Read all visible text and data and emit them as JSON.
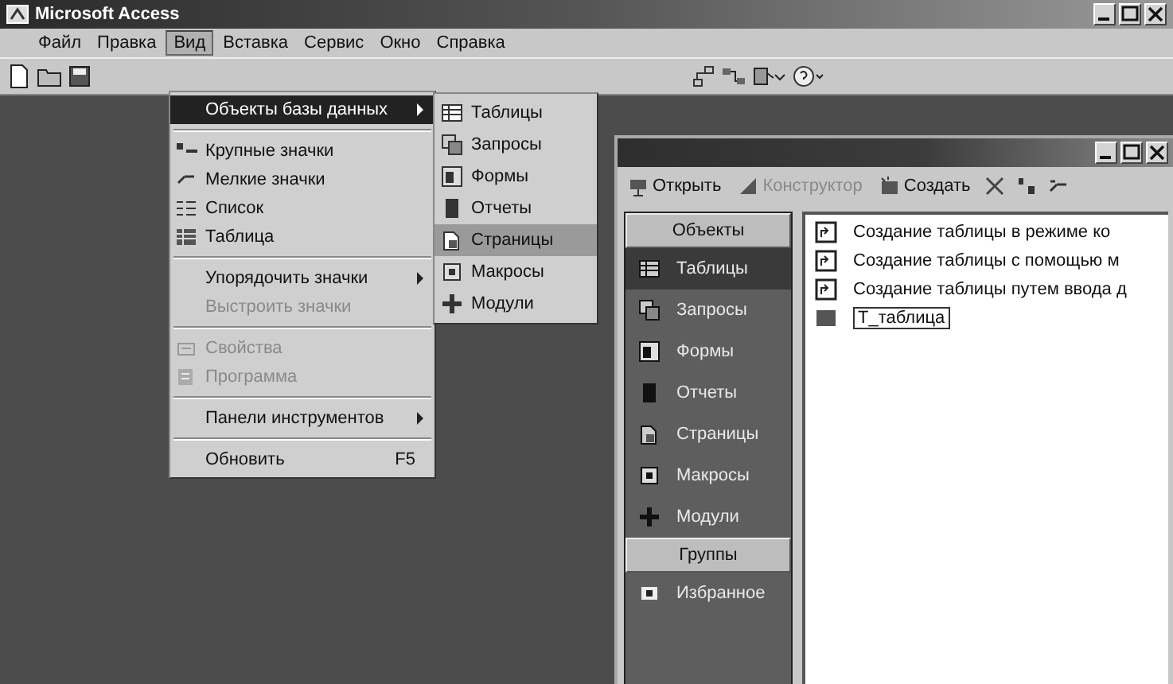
{
  "window": {
    "title": "Microsoft Access"
  },
  "menubar": [
    {
      "label": "Файл",
      "selected": false
    },
    {
      "label": "Правка",
      "selected": false
    },
    {
      "label": "Вид",
      "selected": true
    },
    {
      "label": "Вставка",
      "selected": false
    },
    {
      "label": "Сервис",
      "selected": false
    },
    {
      "label": "Окно",
      "selected": false
    },
    {
      "label": "Справка",
      "selected": false
    }
  ],
  "view_menu": {
    "sections": [
      [
        {
          "label": "Объекты базы данных",
          "submenu": true,
          "disabled": false,
          "selected": true
        }
      ],
      [
        {
          "label": "Крупные значки",
          "submenu": false,
          "disabled": false,
          "selected": false
        },
        {
          "label": "Мелкие значки",
          "submenu": false,
          "disabled": false,
          "selected": false
        },
        {
          "label": "Список",
          "submenu": false,
          "disabled": false,
          "selected": false
        },
        {
          "label": "Таблица",
          "submenu": false,
          "disabled": false,
          "selected": false
        }
      ],
      [
        {
          "label": "Упорядочить значки",
          "submenu": true,
          "disabled": false,
          "selected": false
        },
        {
          "label": "Выстроить значки",
          "submenu": false,
          "disabled": true,
          "selected": false
        }
      ],
      [
        {
          "label": "Свойства",
          "submenu": false,
          "disabled": true,
          "selected": false
        },
        {
          "label": "Программа",
          "submenu": false,
          "disabled": true,
          "selected": false
        }
      ],
      [
        {
          "label": "Панели инструментов",
          "submenu": true,
          "disabled": false,
          "selected": false
        }
      ],
      [
        {
          "label": "Обновить",
          "shortcut": "F5",
          "submenu": false,
          "disabled": false,
          "selected": false
        }
      ]
    ]
  },
  "objects_submenu": [
    {
      "label": "Таблицы",
      "selected": false
    },
    {
      "label": "Запросы",
      "selected": false
    },
    {
      "label": "Формы",
      "selected": false
    },
    {
      "label": "Отчеты",
      "selected": false
    },
    {
      "label": "Страницы",
      "selected": true
    },
    {
      "label": "Макросы",
      "selected": false
    },
    {
      "label": "Модули",
      "selected": false
    }
  ],
  "database_window": {
    "toolbar": [
      {
        "label": "Открыть",
        "disabled": false
      },
      {
        "label": "Конструктор",
        "disabled": true
      },
      {
        "label": "Создать",
        "disabled": false
      }
    ],
    "objects_header": "Объекты",
    "objects": [
      {
        "label": "Таблицы",
        "selected": true
      },
      {
        "label": "Запросы",
        "selected": false
      },
      {
        "label": "Формы",
        "selected": false
      },
      {
        "label": "Отчеты",
        "selected": false
      },
      {
        "label": "Страницы",
        "selected": false
      },
      {
        "label": "Макросы",
        "selected": false
      },
      {
        "label": "Модули",
        "selected": false
      }
    ],
    "groups_header": "Группы",
    "groups": [
      {
        "label": "Избранное",
        "selected": false
      }
    ],
    "items": [
      {
        "kind": "shortcut",
        "label": "Создание таблицы в режиме ко"
      },
      {
        "kind": "shortcut",
        "label": "Создание таблицы с помощью м"
      },
      {
        "kind": "shortcut",
        "label": "Создание таблицы путем ввода д"
      },
      {
        "kind": "rename",
        "label": "Т_таблица"
      }
    ]
  }
}
